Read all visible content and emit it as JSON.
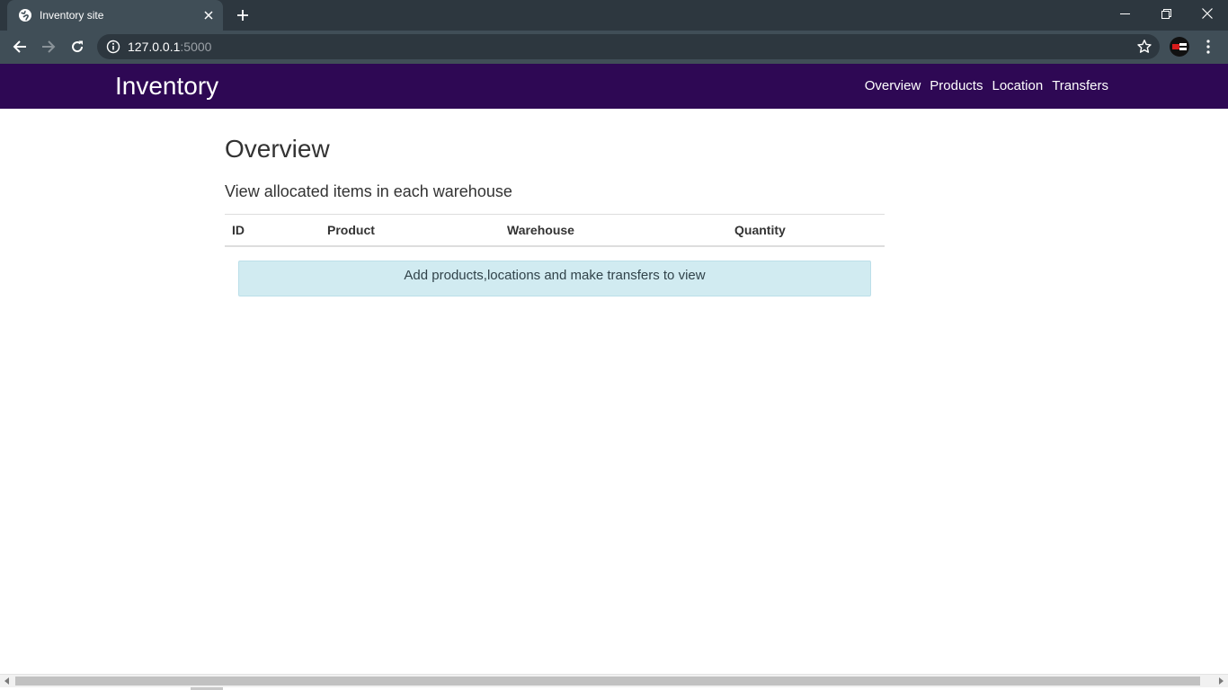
{
  "browser": {
    "tab_title": "Inventory site",
    "url_host": "127.0.0.1",
    "url_port": ":5000"
  },
  "navbar": {
    "brand": "Inventory",
    "links": [
      "Overview",
      "Products",
      "Location",
      "Transfers"
    ],
    "background": "#2e0854"
  },
  "main": {
    "title": "Overview",
    "subtitle": "View allocated items in each warehouse",
    "table": {
      "columns": [
        "ID",
        "Product",
        "Warehouse",
        "Quantity"
      ],
      "rows": []
    },
    "empty_message": "Add products,locations and make transfers to view"
  }
}
